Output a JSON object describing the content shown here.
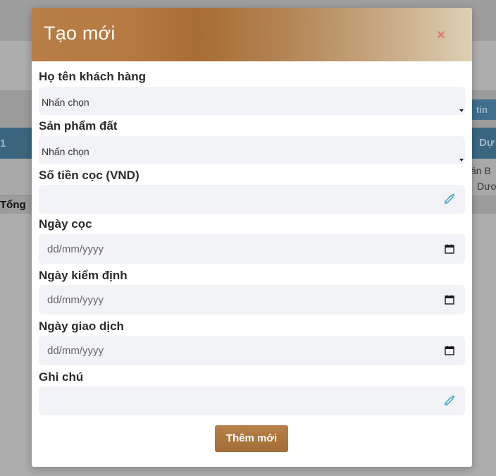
{
  "background": {
    "info_button_label": "tin",
    "table_left_header": "1",
    "table_right_header": "Dự",
    "cell_line_1": "án B",
    "cell_line_2": "Dươ",
    "total_label": "Tổng"
  },
  "modal": {
    "title": "Tạo mới",
    "close_symbol": "×",
    "fields": {
      "customer": {
        "label": "Họ tên khách hàng",
        "value": "Nhấn chọn"
      },
      "product": {
        "label": "Sản phẩm đất",
        "value": "Nhấn chọn"
      },
      "deposit": {
        "label": "Số tiền cọc (VND)",
        "value": ""
      },
      "deposit_date": {
        "label": "Ngày cọc",
        "placeholder": "dd/mm/yyyy"
      },
      "inspection_date": {
        "label": "Ngày kiểm định",
        "placeholder": "dd/mm/yyyy"
      },
      "transaction_date": {
        "label": "Ngày giao dịch",
        "placeholder": "dd/mm/yyyy"
      },
      "note": {
        "label": "Ghi chú",
        "value": ""
      }
    },
    "submit_label": "Thêm mới"
  },
  "icons": {
    "edit": "pencil-icon",
    "calendar": "calendar-icon",
    "close": "close-icon",
    "dropdown": "caret-down-icon"
  },
  "colors": {
    "header_gradient_start": "#b87e47",
    "header_gradient_end": "#ddd0b3",
    "close_icon": "#d97a6e",
    "submit_button": "#ad763f",
    "field_background": "#f2f3f7",
    "pencil_icon": "#4aa8c8"
  }
}
